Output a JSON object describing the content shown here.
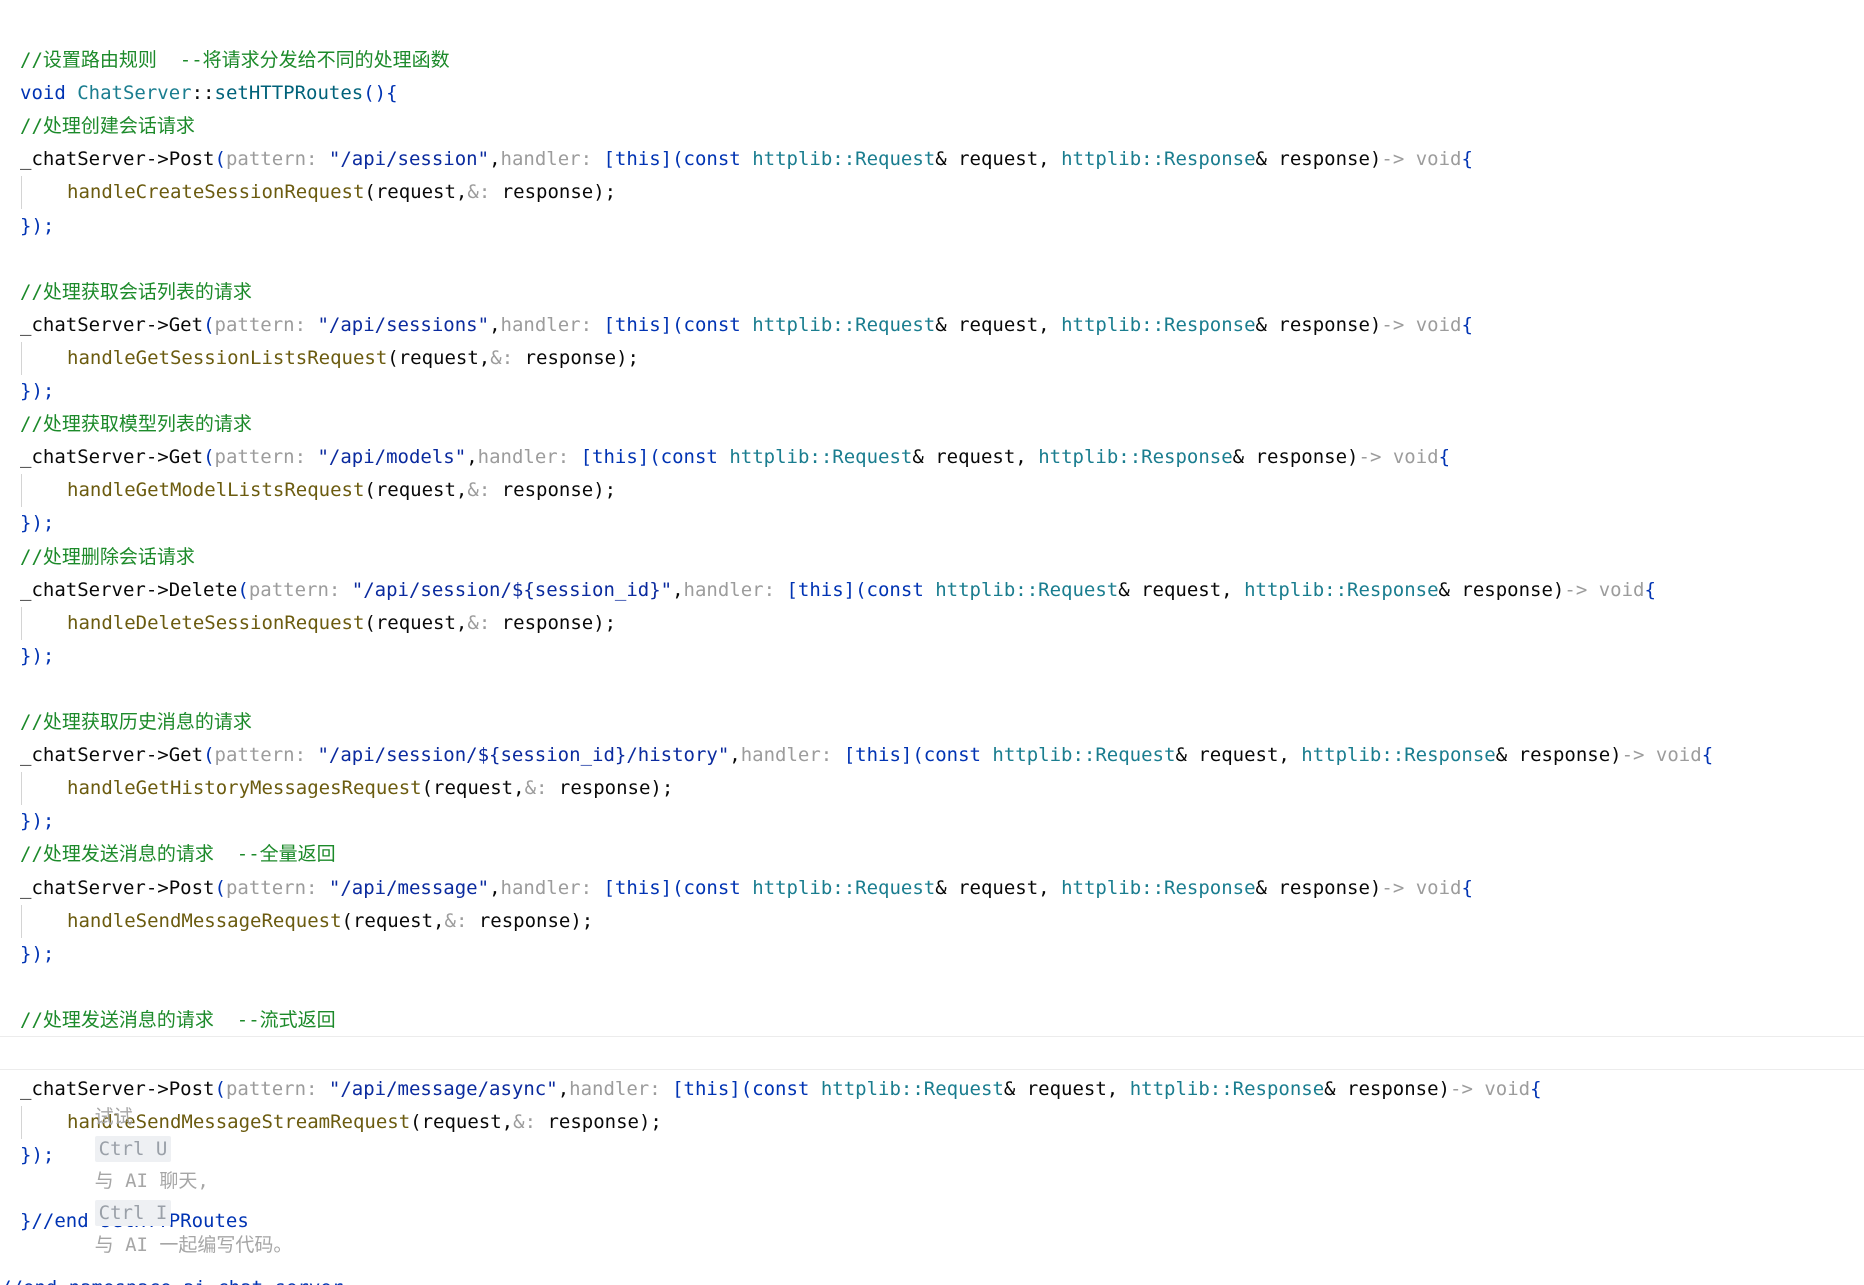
{
  "editor": {
    "lines": [
      {
        "kind": "comment",
        "text": "//设置路由规则  --将请求分发给不同的处理函数"
      },
      {
        "kind": "signature",
        "kw": "void",
        "cls": "ChatServer",
        "sep": "::",
        "fn": "setHTTPRoutes",
        "tail": "(){"
      },
      {
        "kind": "comment",
        "text": "//处理创建会话请求"
      },
      {
        "kind": "route",
        "obj": "_chatServer",
        "arrow": "->",
        "method": "Post",
        "hint_pattern": "pattern:",
        "path": "\"/api/session\"",
        "hint_handler": "handler:",
        "lambda": "[this](const ",
        "req_ns": "httplib::",
        "req_type": "Request",
        "req_tail": "& request, ",
        "res_ns": "httplib::",
        "res_type": "Response",
        "res_tail": "& response)",
        "ret_arrow": "-> ",
        "ret": "void",
        "open": "{"
      },
      {
        "kind": "body",
        "call": "handleCreateSessionRequest",
        "args_a": "(request,",
        "hint_amp": "&:",
        "args_b": " response);"
      },
      {
        "kind": "close",
        "text": "});"
      },
      {
        "kind": "blank",
        "text": ""
      },
      {
        "kind": "comment",
        "text": "//处理获取会话列表的请求"
      },
      {
        "kind": "route",
        "obj": "_chatServer",
        "arrow": "->",
        "method": "Get",
        "hint_pattern": "pattern:",
        "path": "\"/api/sessions\"",
        "hint_handler": "handler:",
        "lambda": "[this](const ",
        "req_ns": "httplib::",
        "req_type": "Request",
        "req_tail": "& request, ",
        "res_ns": "httplib::",
        "res_type": "Response",
        "res_tail": "& response)",
        "ret_arrow": "-> ",
        "ret": "void",
        "open": "{"
      },
      {
        "kind": "body",
        "call": "handleGetSessionListsRequest",
        "args_a": "(request,",
        "hint_amp": "&:",
        "args_b": " response);"
      },
      {
        "kind": "close",
        "text": "});"
      },
      {
        "kind": "comment",
        "text": "//处理获取模型列表的请求"
      },
      {
        "kind": "route",
        "obj": "_chatServer",
        "arrow": "->",
        "method": "Get",
        "hint_pattern": "pattern:",
        "path": "\"/api/models\"",
        "hint_handler": "handler:",
        "lambda": "[this](const ",
        "req_ns": "httplib::",
        "req_type": "Request",
        "req_tail": "& request, ",
        "res_ns": "httplib::",
        "res_type": "Response",
        "res_tail": "& response)",
        "ret_arrow": "-> ",
        "ret": "void",
        "open": "{"
      },
      {
        "kind": "body",
        "call": "handleGetModelListsRequest",
        "args_a": "(request,",
        "hint_amp": "&:",
        "args_b": " response);"
      },
      {
        "kind": "close",
        "text": "});"
      },
      {
        "kind": "comment",
        "text": "//处理删除会话请求"
      },
      {
        "kind": "route",
        "obj": "_chatServer",
        "arrow": "->",
        "method": "Delete",
        "hint_pattern": "pattern:",
        "path": "\"/api/session/${session_id}\"",
        "hint_handler": "handler:",
        "lambda": "[this](const ",
        "req_ns": "httplib::",
        "req_type": "Request",
        "req_tail": "& request, ",
        "res_ns": "httplib::",
        "res_type": "Response",
        "res_tail": "& response)",
        "ret_arrow": "-> ",
        "ret": "void",
        "open": "{"
      },
      {
        "kind": "body",
        "call": "handleDeleteSessionRequest",
        "args_a": "(request,",
        "hint_amp": "&:",
        "args_b": " response);"
      },
      {
        "kind": "close",
        "text": "});"
      },
      {
        "kind": "blank",
        "text": ""
      },
      {
        "kind": "comment",
        "text": "//处理获取历史消息的请求"
      },
      {
        "kind": "route",
        "obj": "_chatServer",
        "arrow": "->",
        "method": "Get",
        "hint_pattern": "pattern:",
        "path": "\"/api/session/${session_id}/history\"",
        "hint_handler": "handler:",
        "lambda": "[this](const ",
        "req_ns": "httplib::",
        "req_type": "Request",
        "req_tail": "& request, ",
        "res_ns": "httplib::",
        "res_type": "Response",
        "res_tail": "& response)",
        "ret_arrow": "-> ",
        "ret": "void",
        "open": "{"
      },
      {
        "kind": "body",
        "call": "handleGetHistoryMessagesRequest",
        "args_a": "(request,",
        "hint_amp": "&:",
        "args_b": " response);"
      },
      {
        "kind": "close",
        "text": "});"
      },
      {
        "kind": "comment",
        "text": "//处理发送消息的请求  --全量返回"
      },
      {
        "kind": "route",
        "obj": "_chatServer",
        "arrow": "->",
        "method": "Post",
        "hint_pattern": "pattern:",
        "path": "\"/api/message\"",
        "hint_handler": "handler:",
        "lambda": "[this](const ",
        "req_ns": "httplib::",
        "req_type": "Request",
        "req_tail": "& request, ",
        "res_ns": "httplib::",
        "res_type": "Response",
        "res_tail": "& response)",
        "ret_arrow": "-> ",
        "ret": "void",
        "open": "{"
      },
      {
        "kind": "body",
        "call": "handleSendMessageRequest",
        "args_a": "(request,",
        "hint_amp": "&:",
        "args_b": " response);"
      },
      {
        "kind": "close",
        "text": "});"
      },
      {
        "kind": "blank",
        "text": ""
      },
      {
        "kind": "comment",
        "text": "//处理发送消息的请求  --流式返回"
      }
    ],
    "ai_hint": {
      "try": "试试",
      "key1": "Ctrl U",
      "mid": "与 AI 聊天,",
      "key2": "Ctrl I",
      "tail": "与 AI 一起编写代码。"
    },
    "lines_after": [
      {
        "kind": "route",
        "obj": "_chatServer",
        "arrow": "->",
        "method": "Post",
        "hint_pattern": "pattern:",
        "path": "\"/api/message/async\"",
        "hint_handler": "handler:",
        "lambda": "[this](const ",
        "req_ns": "httplib::",
        "req_type": "Request",
        "req_tail": "& request, ",
        "res_ns": "httplib::",
        "res_type": "Response",
        "res_tail": "& response)",
        "ret_arrow": "-> ",
        "ret": "void",
        "open": "{"
      },
      {
        "kind": "body",
        "call": "handleSendMessageStreamRequest",
        "args_a": "(request,",
        "hint_amp": "&:",
        "args_b": " response);"
      },
      {
        "kind": "close",
        "text": "});"
      },
      {
        "kind": "blank",
        "text": ""
      },
      {
        "kind": "end",
        "brace": "}",
        "text": "//end setHTTPRoutes"
      },
      {
        "kind": "blank",
        "text": ""
      },
      {
        "kind": "end-flush",
        "text": "//end namespace ai_chat_server"
      }
    ]
  }
}
